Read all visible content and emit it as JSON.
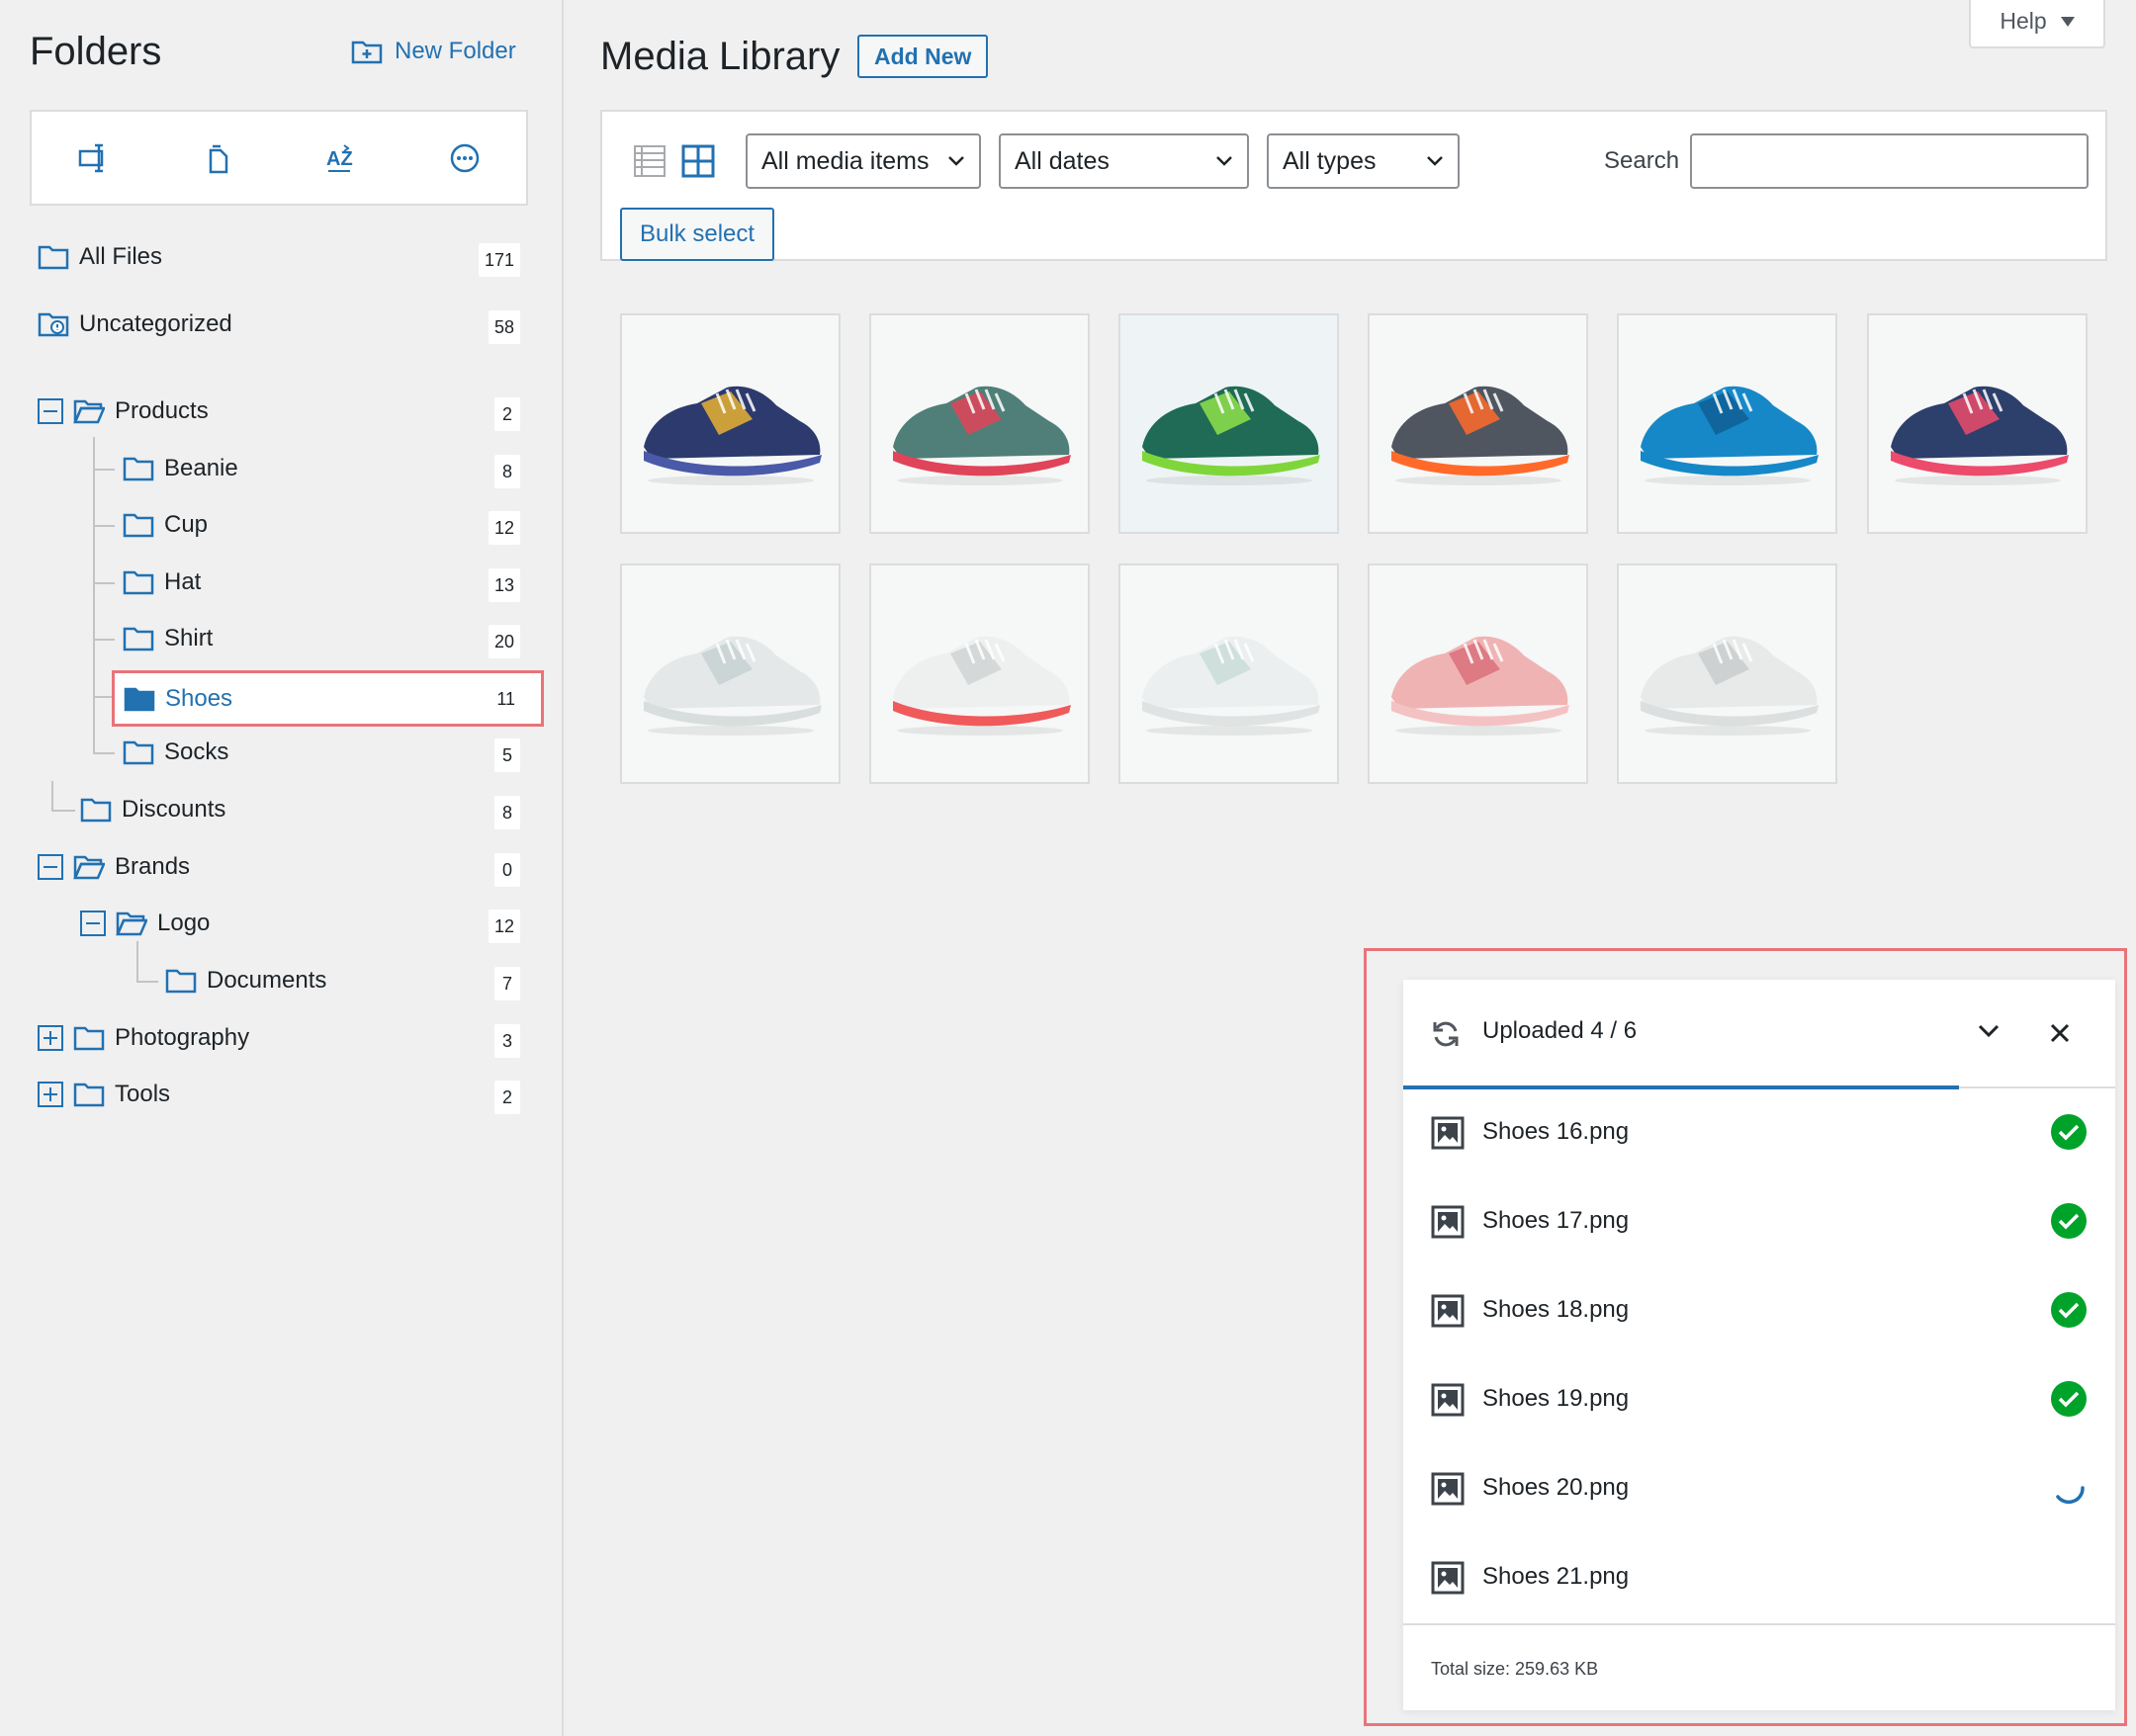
{
  "sidebar": {
    "title": "Folders",
    "new_folder_label": "New Folder",
    "toolbar_icons": [
      "rename-icon",
      "duplicate-icon",
      "sort-az-icon",
      "more-icon"
    ],
    "all_files": {
      "label": "All Files",
      "count": "171"
    },
    "uncategorized": {
      "label": "Uncategorized",
      "count": "58"
    },
    "folders": [
      {
        "label": "Products",
        "count": "2"
      },
      {
        "label": "Beanie",
        "count": "8"
      },
      {
        "label": "Cup",
        "count": "12"
      },
      {
        "label": "Hat",
        "count": "13"
      },
      {
        "label": "Shirt",
        "count": "20"
      },
      {
        "label": "Shoes",
        "count": "11"
      },
      {
        "label": "Socks",
        "count": "5"
      },
      {
        "label": "Discounts",
        "count": "8"
      },
      {
        "label": "Brands",
        "count": "0"
      },
      {
        "label": "Logo",
        "count": "12"
      },
      {
        "label": "Documents",
        "count": "7"
      },
      {
        "label": "Photography",
        "count": "3"
      },
      {
        "label": "Tools",
        "count": "2"
      }
    ]
  },
  "header": {
    "title": "Media Library",
    "add_new": "Add New",
    "help": "Help"
  },
  "filters": {
    "media": "All media items",
    "dates": "All dates",
    "types": "All types",
    "search_label": "Search",
    "bulk_select": "Bulk select"
  },
  "thumbnails": [
    {
      "name": "shoe-navy-yellow",
      "upper": "#2c3a6e",
      "accent": "#e8b332",
      "sole": "#4a5aa8"
    },
    {
      "name": "shoe-teal-red",
      "upper": "#4f7f78",
      "accent": "#e04458",
      "sole": "#e04458"
    },
    {
      "name": "shoe-green-gradient",
      "upper": "#1f6b55",
      "accent": "#8fe04a",
      "sole": "#7fd63a"
    },
    {
      "name": "shoe-grey-orange",
      "upper": "#4f5660",
      "accent": "#ff6a2a",
      "sole": "#ff6a2a"
    },
    {
      "name": "shoe-blue",
      "upper": "#1688c7",
      "accent": "#0f5f95",
      "sole": "#1688c7"
    },
    {
      "name": "shoe-navy-pink",
      "upper": "#2d3f6b",
      "accent": "#ec4b6b",
      "sole": "#ec4b6b"
    },
    {
      "name": "shoe-white-grey",
      "upper": "#e4e8e8",
      "accent": "#c7d1d1",
      "sole": "#d8dede"
    },
    {
      "name": "shoe-white-coral",
      "upper": "#eef0f0",
      "accent": "#d0d4d4",
      "sole": "#f05a5a"
    },
    {
      "name": "shoe-white-mint",
      "upper": "#eceff0",
      "accent": "#c9dcd8",
      "sole": "#dfe3e3"
    },
    {
      "name": "shoe-pink",
      "upper": "#f0b3b3",
      "accent": "#d9707a",
      "sole": "#f4c2c2"
    },
    {
      "name": "shoe-white-silver",
      "upper": "#e8eaea",
      "accent": "#c8cccc",
      "sole": "#dcdfdf"
    }
  ],
  "upload": {
    "title": "Uploaded 4 / 6",
    "progress": 0.78,
    "files": [
      {
        "name": "Shoes 16.png",
        "status": "done"
      },
      {
        "name": "Shoes 17.png",
        "status": "done"
      },
      {
        "name": "Shoes 18.png",
        "status": "done"
      },
      {
        "name": "Shoes 19.png",
        "status": "done"
      },
      {
        "name": "Shoes 20.png",
        "status": "uploading"
      },
      {
        "name": "Shoes 21.png",
        "status": "pending"
      }
    ],
    "total": "Total size: 259.63 KB"
  },
  "colors": {
    "accent": "#2271b1",
    "success": "#00a32a",
    "highlight": "#e87479"
  }
}
